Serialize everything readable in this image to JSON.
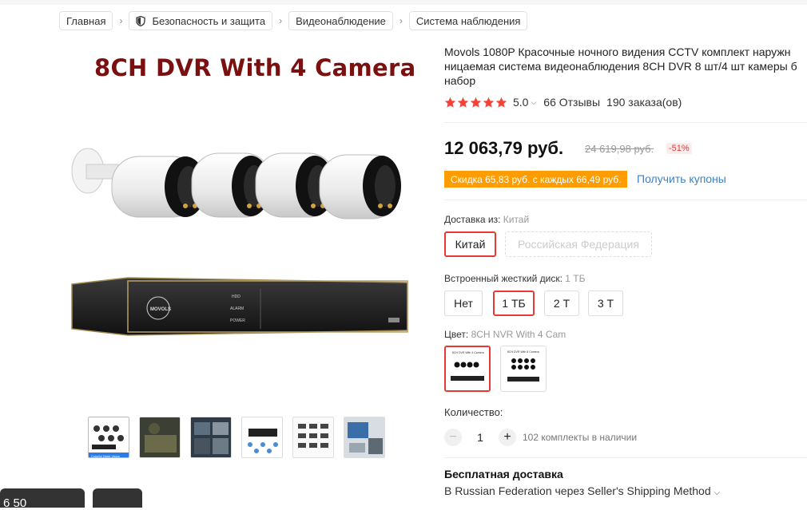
{
  "breadcrumb": {
    "items": [
      "Главная",
      "Безопасность и защита",
      "Видеонаблюдение",
      "Система наблюдения"
    ],
    "separator": "›"
  },
  "gallery": {
    "main_image_heading": "8CH DVR With 4 Camera",
    "dvr_brand": "MOVOLS",
    "dvr_leds": [
      "HDD",
      "ALARM",
      "POWER"
    ],
    "thumbnails": [
      "thumb-1",
      "thumb-2",
      "thumb-3",
      "thumb-4",
      "thumb-5",
      "thumb-6"
    ],
    "thumb_caption": "Colorful Night Vision",
    "float_left_text": "6 50"
  },
  "product": {
    "title": "Movols 1080P Красочные ночного видения CCTV комплект наружн\nницаемая система видеонаблюдения 8CH DVR 8 шт/4 шт камеры б\nнабор",
    "rating_value": "5.0",
    "reviews": "66 Отзывы",
    "orders": "190 заказа(ов)",
    "price": "12 063,79 руб.",
    "old_price": "24 619,98 руб.",
    "discount": "-51%",
    "coupon_text": "Скидка 65,83 руб. с каждых 66,49 руб.",
    "coupon_link": "Получить купоны"
  },
  "shipping_from": {
    "label": "Доставка из:",
    "value": "Китай",
    "options": [
      "Китай",
      "Российская Федерация"
    ]
  },
  "hdd": {
    "label": "Встроенный жесткий диск:",
    "value": "1 ТБ",
    "options": [
      "Нет",
      "1 ТБ",
      "2 Т",
      "3 Т"
    ]
  },
  "color": {
    "label": "Цвет:",
    "value": "8CH NVR With 4 Cam",
    "swatch_captions": [
      "8CH DVR With 4 Camera",
      "8CH DVR With 8 Camera"
    ]
  },
  "quantity": {
    "label": "Количество:",
    "value": "1",
    "minus": "−",
    "plus": "+",
    "stock": "102 комплекты в наличии"
  },
  "delivery": {
    "title": "Бесплатная доставка",
    "subtitle": "В Russian Federation через Seller's Shipping Method"
  },
  "colors": {
    "accent_red": "#e53935",
    "star": "#f44336",
    "coupon_orange": "#ff9d00",
    "link_blue": "#3b82c4",
    "heading_red": "#7a1010"
  }
}
